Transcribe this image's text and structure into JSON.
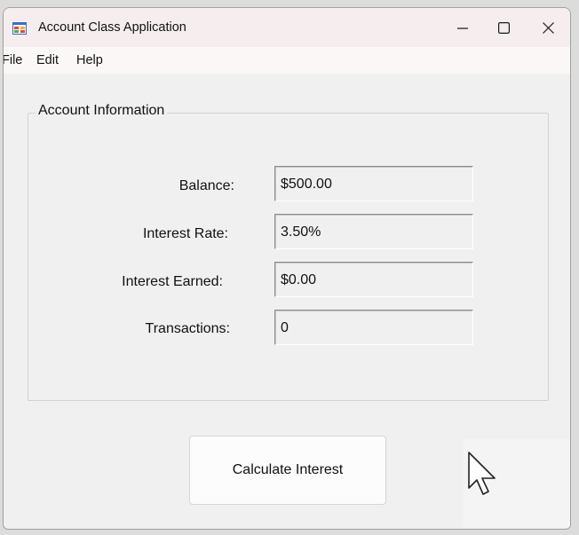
{
  "window": {
    "title": "Account Class Application",
    "icon": "windows-form-icon",
    "controls": {
      "minimize_icon": "minimize-icon",
      "maximize_icon": "maximize-icon",
      "close_icon": "close-icon"
    }
  },
  "menu": {
    "items": [
      {
        "label": "File"
      },
      {
        "label": "Edit"
      },
      {
        "label": "Help"
      }
    ]
  },
  "account_group": {
    "title": "Account Information",
    "fields": [
      {
        "label": "Balance:",
        "value": "$500.00"
      },
      {
        "label": "Interest Rate:",
        "value": "3.50%"
      },
      {
        "label": "Interest Earned:",
        "value": "$0.00"
      },
      {
        "label": "Transactions:",
        "value": "0"
      }
    ]
  },
  "actions": {
    "calculate_label": "Calculate Interest"
  },
  "cursor": {
    "icon": "mouse-pointer-icon"
  },
  "colors": {
    "window_bg": "#f0f0f0",
    "titlebar_bg": "#f6eeee",
    "menubar_bg": "#fbf7f7",
    "button_bg": "#fcfcfc"
  }
}
